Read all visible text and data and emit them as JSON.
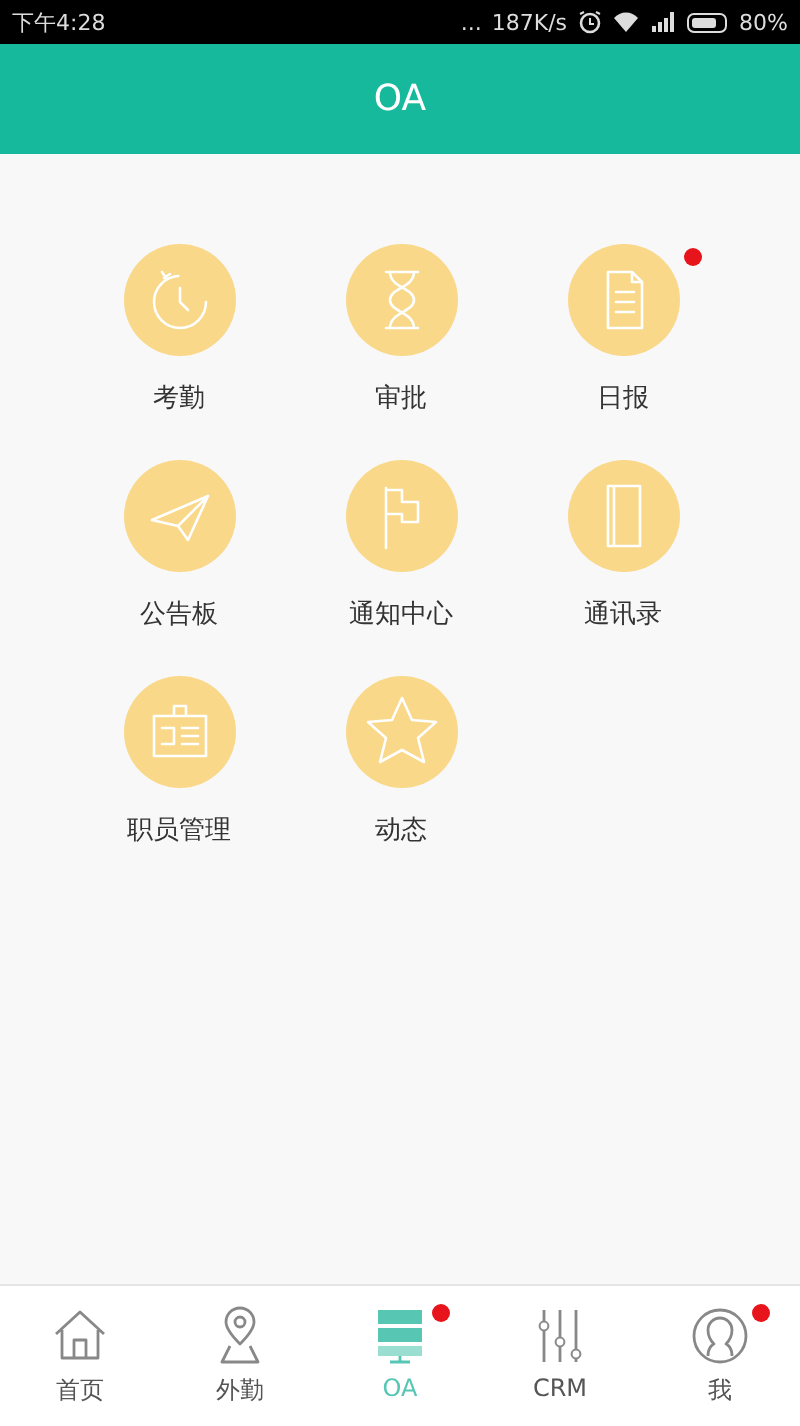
{
  "status_bar": {
    "time": "下午4:28",
    "more": "...",
    "network_speed": "187K/s",
    "battery": "80%"
  },
  "header": {
    "title": "OA"
  },
  "apps": [
    {
      "label": "考勤",
      "kind": "clock",
      "badge": false
    },
    {
      "label": "审批",
      "kind": "hourglass",
      "badge": false
    },
    {
      "label": "日报",
      "kind": "document",
      "badge": true
    },
    {
      "label": "公告板",
      "kind": "plane",
      "badge": false
    },
    {
      "label": "通知中心",
      "kind": "flag",
      "badge": false
    },
    {
      "label": "通讯录",
      "kind": "book",
      "badge": false
    },
    {
      "label": "职员管理",
      "kind": "badge-card",
      "badge": false
    },
    {
      "label": "动态",
      "kind": "star",
      "badge": false
    }
  ],
  "tabs": [
    {
      "label": "首页",
      "kind": "home",
      "selected": false,
      "badge": false
    },
    {
      "label": "外勤",
      "kind": "pin",
      "selected": false,
      "badge": false
    },
    {
      "label": "OA",
      "kind": "server",
      "selected": true,
      "badge": true
    },
    {
      "label": "CRM",
      "kind": "sliders",
      "selected": false,
      "badge": false
    },
    {
      "label": "我",
      "kind": "person",
      "selected": false,
      "badge": true
    }
  ]
}
